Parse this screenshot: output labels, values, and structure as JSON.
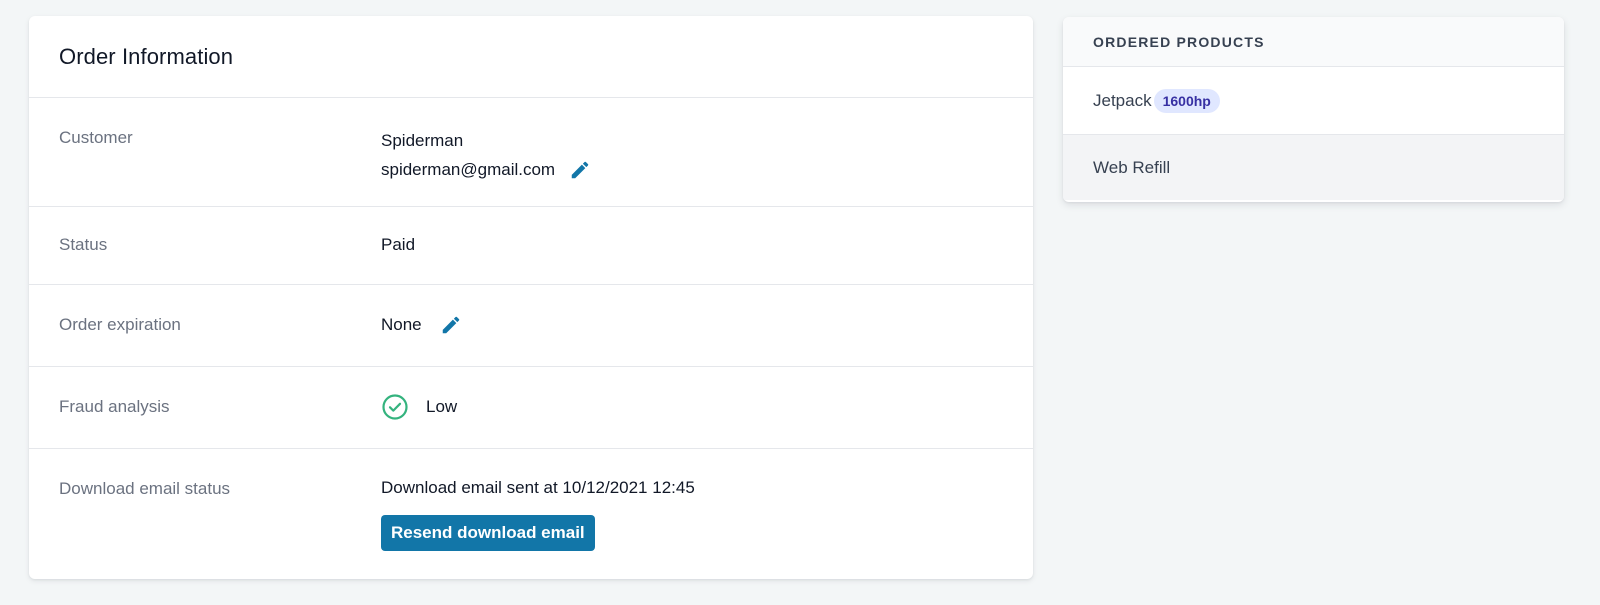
{
  "order": {
    "title": "Order Information",
    "rows": {
      "customer": {
        "label": "Customer",
        "name": "Spiderman",
        "email": "spiderman@gmail.com",
        "edit_icon": "pencil-icon"
      },
      "status": {
        "label": "Status",
        "value": "Paid"
      },
      "expiration": {
        "label": "Order expiration",
        "value": "None",
        "edit_icon": "pencil-icon"
      },
      "fraud": {
        "label": "Fraud analysis",
        "value": "Low",
        "icon": "check-circle-icon",
        "icon_color": "#34b37e"
      },
      "download": {
        "label": "Download email status",
        "value": "Download email sent at 10/12/2021 12:45",
        "button_label": "Resend download email"
      }
    }
  },
  "products": {
    "title": "Ordered products",
    "items": [
      {
        "name": "Jetpack",
        "badge": "1600hp"
      },
      {
        "name": "Web Refill"
      }
    ]
  },
  "colors": {
    "accent": "#1276a8",
    "badge_bg": "#e0e7ff",
    "badge_text": "#3730a3",
    "success": "#34b37e"
  }
}
